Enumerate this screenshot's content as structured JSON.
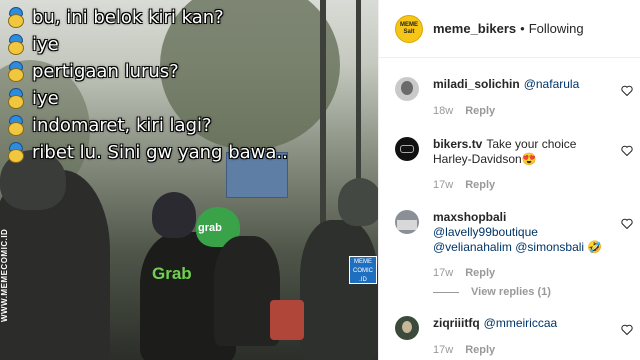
{
  "post": {
    "chat_lines": [
      "bu, ini belok kiri kan?",
      "iye",
      "pertigaan lurus?",
      "iye",
      "indomaret, kiri lagi?",
      "ribet lu. Sini gw yang bawa.."
    ],
    "jacket_text": "Grab",
    "helmet_text": "grab",
    "watermark_side": "WWW.MEMECOMIC.ID",
    "watermark_logo": "MEME COMIC .ID"
  },
  "header": {
    "avatar_text": "MEME Salt",
    "username": "meme_bikers",
    "separator": "•",
    "follow_status": "Following"
  },
  "comments": [
    {
      "username": "miladi_solichin",
      "text": "",
      "mentions": "@nafarula",
      "time": "18w",
      "reply_label": "Reply"
    },
    {
      "username": "bikers.tv",
      "text": "Take your choice Harley-Davidson😍",
      "mentions": "",
      "time": "17w",
      "reply_label": "Reply"
    },
    {
      "username": "maxshopbali",
      "text": "",
      "mentions": "@lavelly99boutique @velianahalim @simonsbali 🤣",
      "time": "17w",
      "reply_label": "Reply",
      "view_replies": "View replies (1)"
    },
    {
      "username": "ziqriiitfq",
      "text": "",
      "mentions": "@mmeiriccaa",
      "time": "17w",
      "reply_label": "Reply"
    }
  ],
  "icons": {
    "heart": "heart-outline-icon",
    "chat_avatar": "helmet-emoji-icon"
  },
  "colors": {
    "chat_text": "#ffffff",
    "grab_green": "#6fd24f",
    "meta_gray": "#999999",
    "mention_blue": "#003569"
  }
}
